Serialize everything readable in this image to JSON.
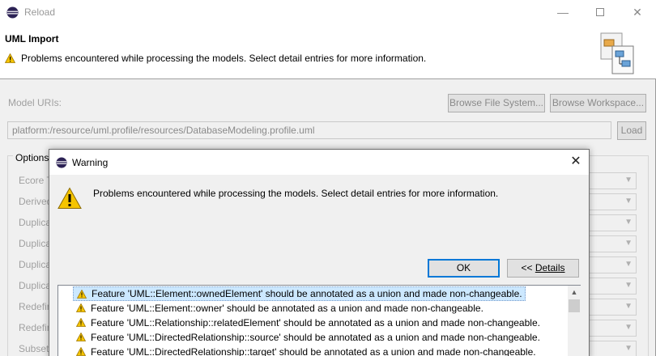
{
  "window": {
    "title": "Reload",
    "controls": {
      "minimize": "—",
      "close": "✕"
    }
  },
  "header": {
    "title": "UML Import",
    "message": "Problems encountered while processing the models. Select detail entries for more information."
  },
  "model_uris": {
    "label": "Model URIs:",
    "browse_file_system": "Browse File System...",
    "browse_workspace": "Browse Workspace...",
    "value": "platform:/resource/uml.profile/resources/DatabaseModeling.profile.uml",
    "load": "Load"
  },
  "options": {
    "title": "Options",
    "items": [
      "Ecore T",
      "Derived",
      "Duplica",
      "Duplica",
      "Duplica",
      "Duplica",
      "Redefin",
      "Redefin",
      "Subset"
    ]
  },
  "dialog": {
    "title": "Warning",
    "close": "✕",
    "message": "Problems encountered while processing the models. Select detail entries for more information.",
    "ok_label": "OK",
    "details_prefix": "<< ",
    "details_label": "Details",
    "entries": [
      "Feature 'UML::Element::ownedElement' should be annotated as a union and made non-changeable.",
      "Feature 'UML::Element::owner' should be annotated as a union and made non-changeable.",
      "Feature 'UML::Relationship::relatedElement' should be annotated as a union and made non-changeable.",
      "Feature 'UML::DirectedRelationship::source' should be annotated as a union and made non-changeable.",
      "Feature 'UML::DirectedRelationship::target' should be annotated as a union and made non-changeable."
    ],
    "selected_entry": 0
  },
  "colors": {
    "selection": "#cce8ff",
    "default_button_border": "#0078d7",
    "warning_yellow": "#f5c400"
  }
}
